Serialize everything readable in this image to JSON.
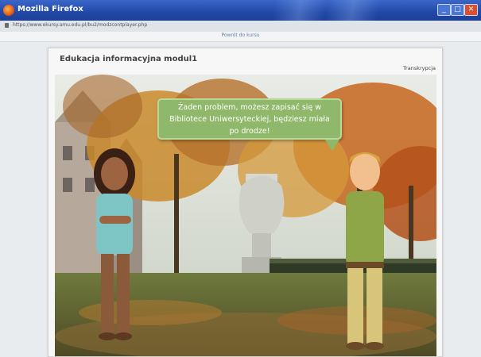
{
  "browser": {
    "window_title": "Mozilla Firefox",
    "url": "https://www.ekursy.amu.edu.pl/bu2/modzcontplayer.php",
    "return_link": "Powrót do kursu"
  },
  "course": {
    "title": "Edukacja informacyjna modul1",
    "transcript_link": "Transkrypcja"
  },
  "scene": {
    "speech_bubble": "Żaden problem, możesz zapisać się w Bibliotece Uniwersyteckiej, będziesz miała po drodze!"
  }
}
